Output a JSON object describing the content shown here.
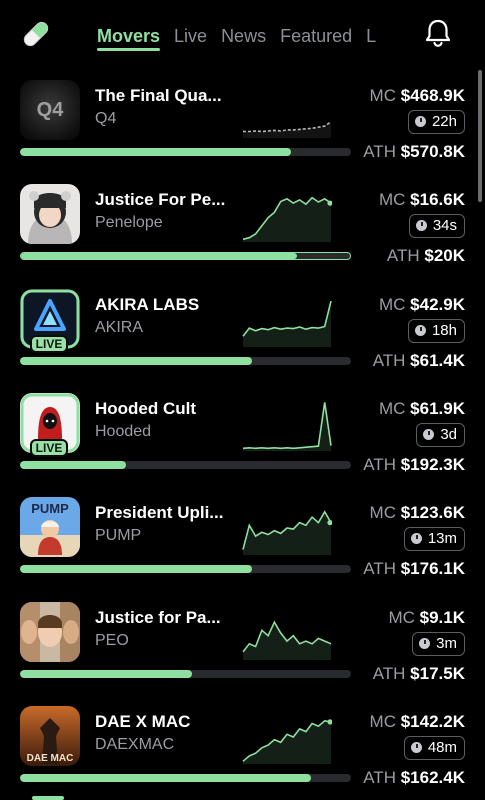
{
  "colors": {
    "accent": "#8fe0a0",
    "background": "#000000",
    "muted": "#9b9da3"
  },
  "header": {
    "logo_icon": "pill-icon",
    "tabs": [
      {
        "label": "Movers",
        "active": true
      },
      {
        "label": "Live",
        "active": false
      },
      {
        "label": "News",
        "active": false
      },
      {
        "label": "Featured",
        "active": false
      },
      {
        "label": "L",
        "active": false
      }
    ],
    "notification_icon": "bell-icon"
  },
  "coins": [
    {
      "name": "The Final Qua...",
      "ticker": "Q4",
      "mc_label": "MC",
      "mc": "$468.9K",
      "age": "22h",
      "ath_label": "ATH",
      "ath": "$570.8K",
      "progress": 0.82,
      "live": false,
      "avatar": "q4-logo",
      "spark": [
        0.12,
        0.12,
        0.13,
        0.12,
        0.13,
        0.14,
        0.13,
        0.15,
        0.15,
        0.16,
        0.17,
        0.18,
        0.2,
        0.22,
        0.3
      ]
    },
    {
      "name": "Justice For Pe...",
      "ticker": "Penelope",
      "mc_label": "MC",
      "mc": "$16.6K",
      "age": "34s",
      "ath_label": "ATH",
      "ath": "$20K",
      "progress": 0.84,
      "live": false,
      "avatar": "girl-photo",
      "spark": [
        0.05,
        0.08,
        0.15,
        0.3,
        0.45,
        0.55,
        0.75,
        0.8,
        0.72,
        0.78,
        0.7,
        0.82,
        0.74,
        0.8,
        0.72
      ]
    },
    {
      "name": "AKIRA LABS",
      "ticker": "AKIRA",
      "mc_label": "MC",
      "mc": "$42.9K",
      "age": "18h",
      "ath_label": "ATH",
      "ath": "$61.4K",
      "progress": 0.7,
      "live": true,
      "avatar": "akira-logo",
      "spark": [
        0.2,
        0.35,
        0.3,
        0.34,
        0.32,
        0.36,
        0.33,
        0.35,
        0.34,
        0.37,
        0.33,
        0.36,
        0.35,
        0.38,
        0.85
      ]
    },
    {
      "name": "Hooded Cult",
      "ticker": "Hooded",
      "mc_label": "MC",
      "mc": "$61.9K",
      "age": "3d",
      "ath_label": "ATH",
      "ath": "$192.3K",
      "progress": 0.32,
      "live": true,
      "avatar": "hooded-figure",
      "spark": [
        0.05,
        0.06,
        0.05,
        0.06,
        0.05,
        0.06,
        0.05,
        0.06,
        0.05,
        0.06,
        0.07,
        0.08,
        0.09,
        0.9,
        0.1
      ]
    },
    {
      "name": "President Upli...",
      "ticker": "PUMP",
      "mc_label": "MC",
      "mc": "$123.6K",
      "age": "13m",
      "ath_label": "ATH",
      "ath": "$176.1K",
      "progress": 0.7,
      "live": false,
      "avatar": "pump-art",
      "spark": [
        0.1,
        0.55,
        0.35,
        0.42,
        0.38,
        0.45,
        0.4,
        0.5,
        0.48,
        0.6,
        0.55,
        0.7,
        0.6,
        0.8,
        0.6
      ]
    },
    {
      "name": "Justice for Pa...",
      "ticker": "PEO",
      "mc_label": "MC",
      "mc": "$9.1K",
      "age": "3m",
      "ath_label": "ATH",
      "ath": "$17.5K",
      "progress": 0.52,
      "live": false,
      "avatar": "kids-photo",
      "spark": [
        0.15,
        0.3,
        0.25,
        0.55,
        0.45,
        0.7,
        0.5,
        0.35,
        0.45,
        0.3,
        0.35,
        0.3,
        0.4,
        0.35,
        0.3
      ]
    },
    {
      "name": "DAE X MAC",
      "ticker": "DAEXMAC",
      "mc_label": "MC",
      "mc": "$142.2K",
      "age": "48m",
      "ath_label": "ATH",
      "ath": "$162.4K",
      "progress": 0.88,
      "live": false,
      "avatar": "daexmac-art",
      "spark": [
        0.05,
        0.15,
        0.2,
        0.3,
        0.35,
        0.45,
        0.4,
        0.55,
        0.5,
        0.65,
        0.6,
        0.75,
        0.7,
        0.8,
        0.78
      ]
    }
  ]
}
